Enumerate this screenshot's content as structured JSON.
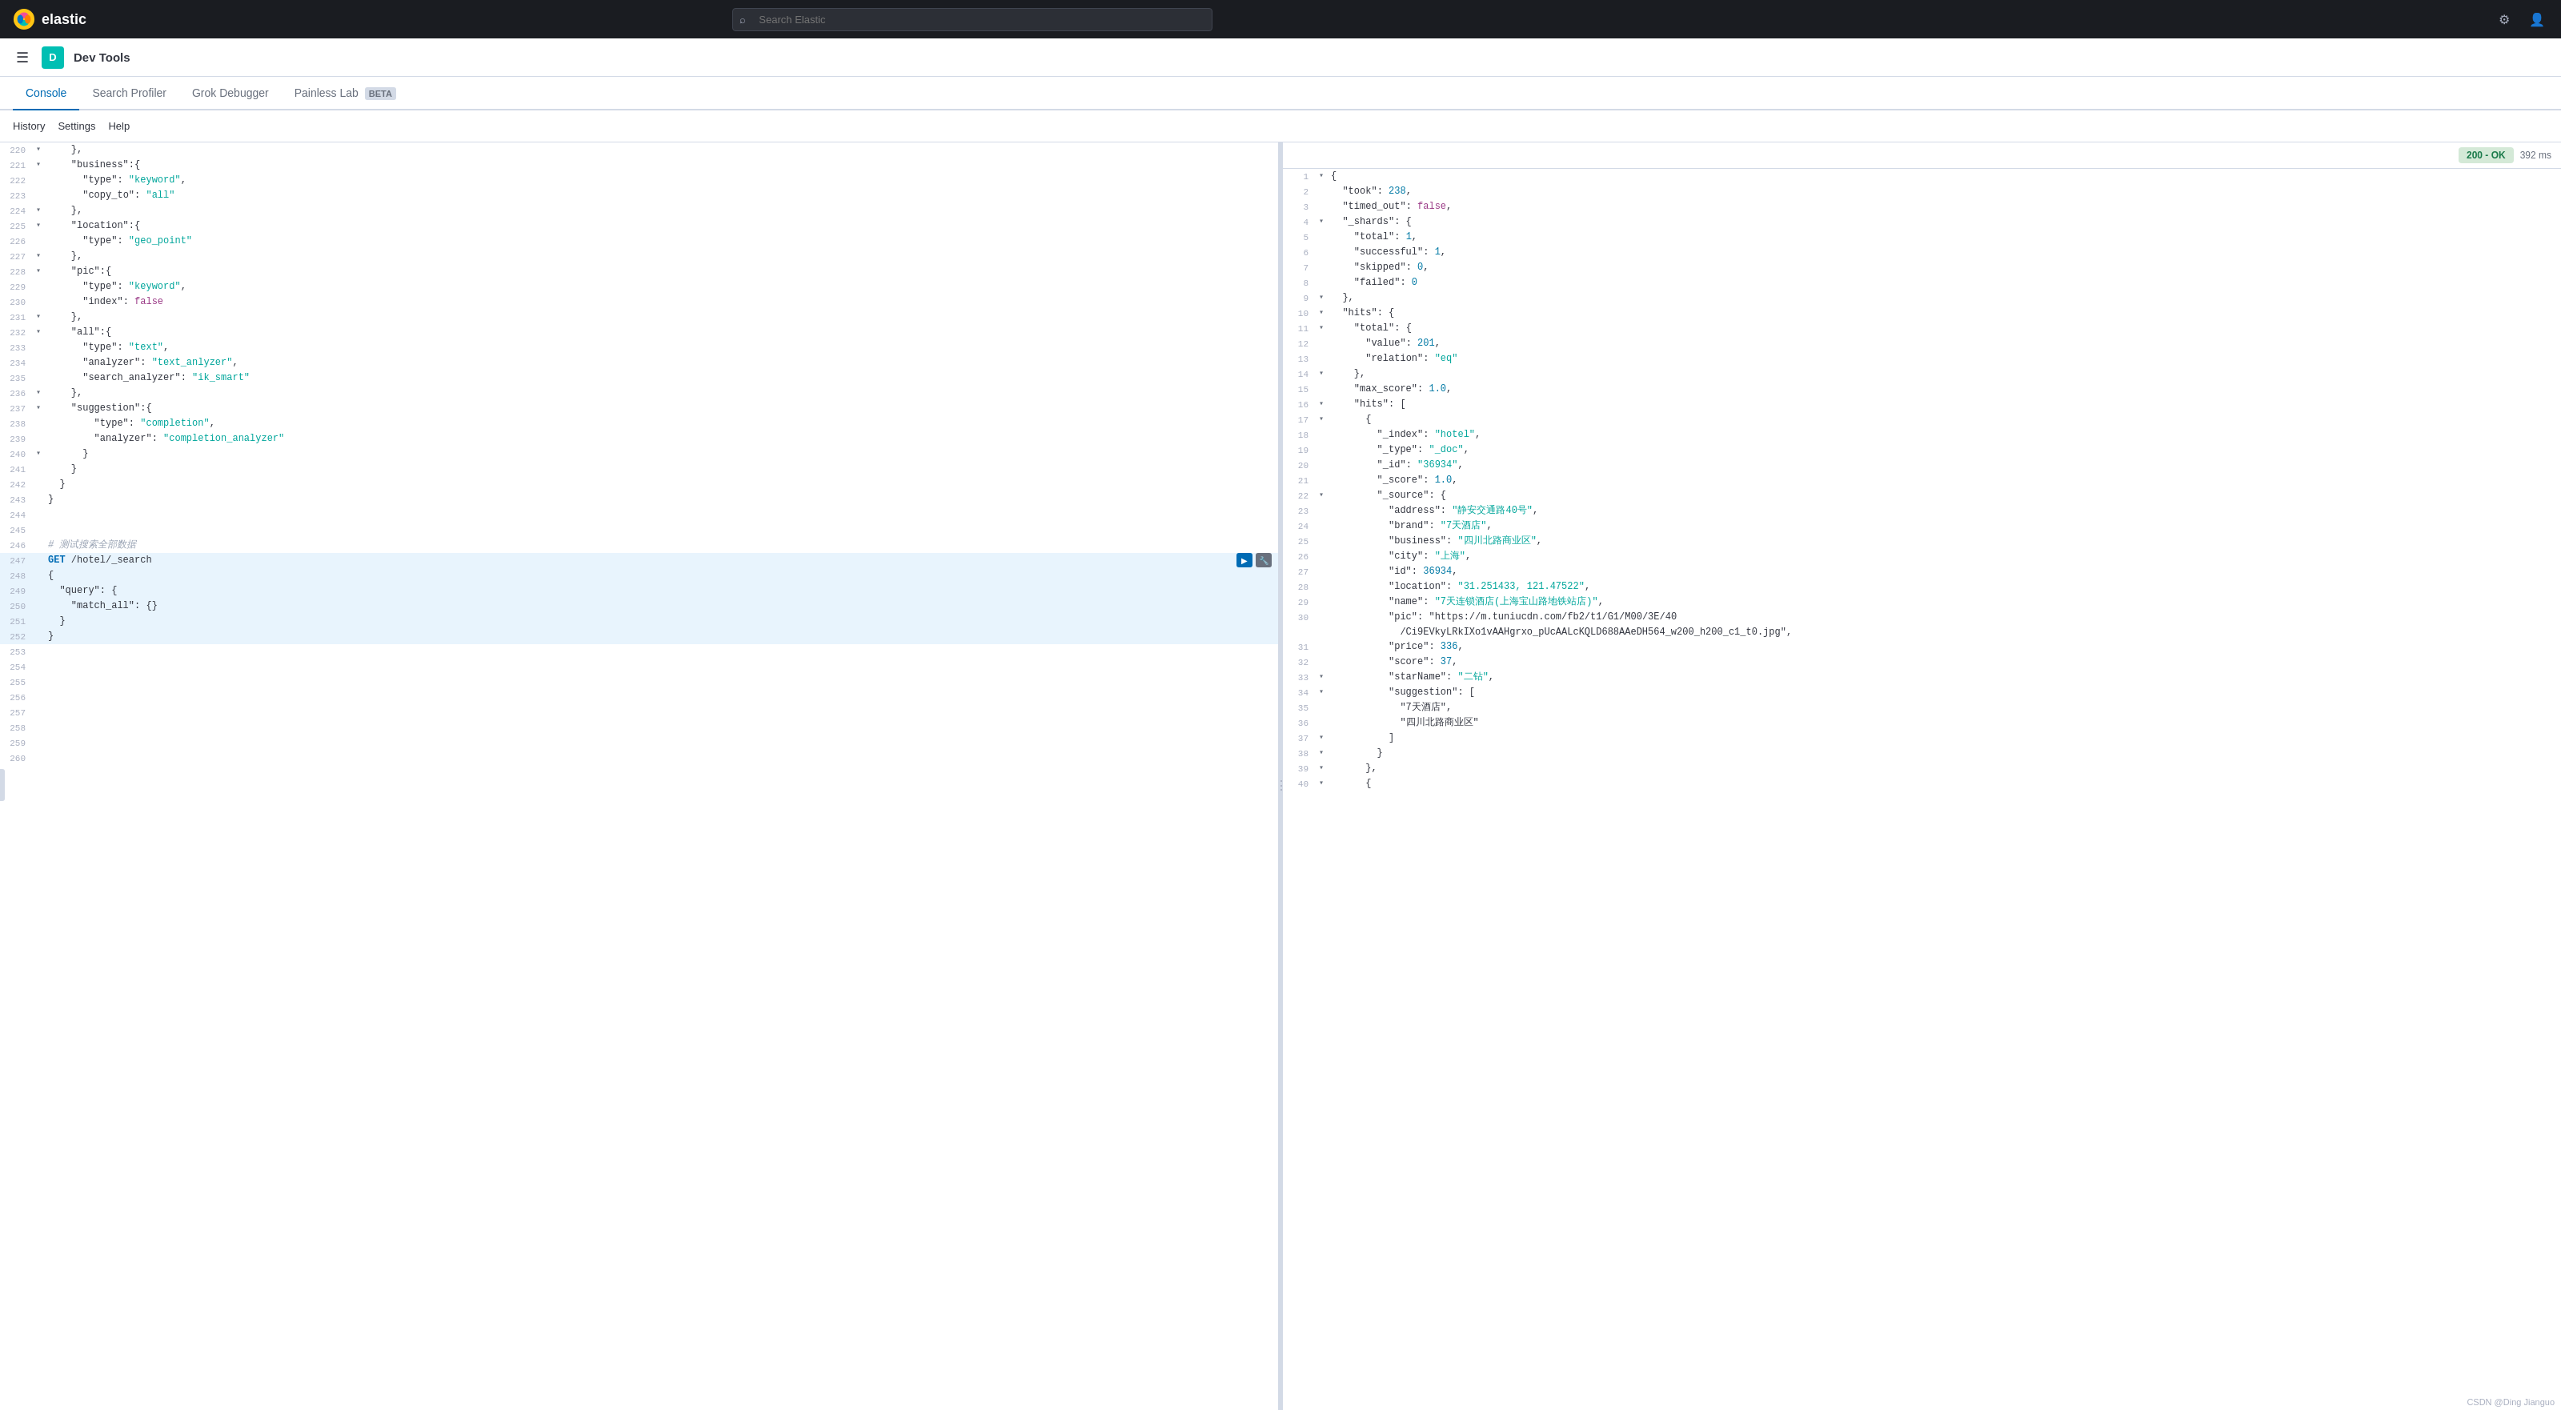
{
  "navbar": {
    "logo_text": "elastic",
    "search_placeholder": "Search Elastic",
    "search_value": ""
  },
  "secondary_header": {
    "app_avatar": "D",
    "app_title": "Dev Tools"
  },
  "tabs": [
    {
      "id": "console",
      "label": "Console",
      "active": true,
      "beta": false
    },
    {
      "id": "search-profiler",
      "label": "Search Profiler",
      "active": false,
      "beta": false
    },
    {
      "id": "grok-debugger",
      "label": "Grok Debugger",
      "active": false,
      "beta": false
    },
    {
      "id": "painless-lab",
      "label": "Painless Lab",
      "active": false,
      "beta": true
    }
  ],
  "beta_label": "BETA",
  "toolbar": {
    "history": "History",
    "settings": "Settings",
    "help": "Help"
  },
  "status": {
    "code": "200 - OK",
    "time": "392 ms"
  },
  "editor_lines": [
    {
      "num": 220,
      "gutter": "▾",
      "content": "    },"
    },
    {
      "num": 221,
      "gutter": "▾",
      "content": "    \"business\":{"
    },
    {
      "num": 222,
      "gutter": "",
      "content": "      \"type\": \"keyword\","
    },
    {
      "num": 223,
      "gutter": "",
      "content": "      \"copy_to\": \"all\""
    },
    {
      "num": 224,
      "gutter": "▾",
      "content": "    },"
    },
    {
      "num": 225,
      "gutter": "▾",
      "content": "    \"location\":{"
    },
    {
      "num": 226,
      "gutter": "",
      "content": "      \"type\": \"geo_point\""
    },
    {
      "num": 227,
      "gutter": "▾",
      "content": "    },"
    },
    {
      "num": 228,
      "gutter": "▾",
      "content": "    \"pic\":{"
    },
    {
      "num": 229,
      "gutter": "",
      "content": "      \"type\": \"keyword\","
    },
    {
      "num": 230,
      "gutter": "",
      "content": "      \"index\": false"
    },
    {
      "num": 231,
      "gutter": "▾",
      "content": "    },"
    },
    {
      "num": 232,
      "gutter": "▾",
      "content": "    \"all\":{"
    },
    {
      "num": 233,
      "gutter": "",
      "content": "      \"type\": \"text\","
    },
    {
      "num": 234,
      "gutter": "",
      "content": "      \"analyzer\": \"text_anlyzer\","
    },
    {
      "num": 235,
      "gutter": "",
      "content": "      \"search_analyzer\": \"ik_smart\""
    },
    {
      "num": 236,
      "gutter": "▾",
      "content": "    },"
    },
    {
      "num": 237,
      "gutter": "▾",
      "content": "    \"suggestion\":{"
    },
    {
      "num": 238,
      "gutter": "",
      "content": "        \"type\": \"completion\","
    },
    {
      "num": 239,
      "gutter": "",
      "content": "        \"analyzer\": \"completion_analyzer\""
    },
    {
      "num": 240,
      "gutter": "▾",
      "content": "      }"
    },
    {
      "num": 241,
      "gutter": "",
      "content": "    }"
    },
    {
      "num": 242,
      "gutter": "",
      "content": "  }"
    },
    {
      "num": 243,
      "gutter": "",
      "content": "}"
    },
    {
      "num": 244,
      "gutter": "",
      "content": ""
    },
    {
      "num": 245,
      "gutter": "",
      "content": ""
    },
    {
      "num": 246,
      "gutter": "",
      "content": "# 测试搜索全部数据"
    },
    {
      "num": 247,
      "gutter": "",
      "content": "GET /hotel/_search",
      "active": true,
      "has_actions": true
    },
    {
      "num": 248,
      "gutter": "",
      "content": "{",
      "active": true
    },
    {
      "num": 249,
      "gutter": "",
      "content": "  \"query\": {",
      "active": true
    },
    {
      "num": 250,
      "gutter": "",
      "content": "    \"match_all\": {}",
      "active": true
    },
    {
      "num": 251,
      "gutter": "",
      "content": "  }",
      "active": true
    },
    {
      "num": 252,
      "gutter": "",
      "content": "}",
      "active": true
    },
    {
      "num": 253,
      "gutter": "",
      "content": ""
    },
    {
      "num": 254,
      "gutter": "",
      "content": ""
    },
    {
      "num": 255,
      "gutter": "",
      "content": ""
    },
    {
      "num": 256,
      "gutter": "",
      "content": ""
    },
    {
      "num": 257,
      "gutter": "",
      "content": ""
    },
    {
      "num": 258,
      "gutter": "",
      "content": ""
    },
    {
      "num": 259,
      "gutter": "",
      "content": ""
    },
    {
      "num": 260,
      "gutter": "",
      "content": ""
    }
  ],
  "output_lines": [
    {
      "num": 1,
      "gutter": "▾",
      "content": "{"
    },
    {
      "num": 2,
      "gutter": "",
      "content": "  \"took\" : 238,"
    },
    {
      "num": 3,
      "gutter": "",
      "content": "  \"timed_out\" : false,"
    },
    {
      "num": 4,
      "gutter": "▾",
      "content": "  \"_shards\" : {"
    },
    {
      "num": 5,
      "gutter": "",
      "content": "    \"total\" : 1,"
    },
    {
      "num": 6,
      "gutter": "",
      "content": "    \"successful\" : 1,"
    },
    {
      "num": 7,
      "gutter": "",
      "content": "    \"skipped\" : 0,"
    },
    {
      "num": 8,
      "gutter": "",
      "content": "    \"failed\" : 0"
    },
    {
      "num": 9,
      "gutter": "▾",
      "content": "  },"
    },
    {
      "num": 10,
      "gutter": "▾",
      "content": "  \"hits\" : {"
    },
    {
      "num": 11,
      "gutter": "▾",
      "content": "    \"total\" : {"
    },
    {
      "num": 12,
      "gutter": "",
      "content": "      \"value\" : 201,"
    },
    {
      "num": 13,
      "gutter": "",
      "content": "      \"relation\" : \"eq\""
    },
    {
      "num": 14,
      "gutter": "▾",
      "content": "    },"
    },
    {
      "num": 15,
      "gutter": "",
      "content": "    \"max_score\" : 1.0,"
    },
    {
      "num": 16,
      "gutter": "▾",
      "content": "    \"hits\" : ["
    },
    {
      "num": 17,
      "gutter": "▾",
      "content": "      {"
    },
    {
      "num": 18,
      "gutter": "",
      "content": "        \"_index\" : \"hotel\","
    },
    {
      "num": 19,
      "gutter": "",
      "content": "        \"_type\" : \"_doc\","
    },
    {
      "num": 20,
      "gutter": "",
      "content": "        \"_id\" : \"36934\","
    },
    {
      "num": 21,
      "gutter": "",
      "content": "        \"_score\" : 1.0,"
    },
    {
      "num": 22,
      "gutter": "▾",
      "content": "        \"_source\" : {"
    },
    {
      "num": 23,
      "gutter": "",
      "content": "          \"address\" : \"静安交通路40号\","
    },
    {
      "num": 24,
      "gutter": "",
      "content": "          \"brand\" : \"7天酒店\","
    },
    {
      "num": 25,
      "gutter": "",
      "content": "          \"business\" : \"四川北路商业区\","
    },
    {
      "num": 26,
      "gutter": "",
      "content": "          \"city\" : \"上海\","
    },
    {
      "num": 27,
      "gutter": "",
      "content": "          \"id\" : 36934,"
    },
    {
      "num": 28,
      "gutter": "",
      "content": "          \"location\" : \"31.251433, 121.47522\","
    },
    {
      "num": 29,
      "gutter": "",
      "content": "          \"name\" : \"7天连锁酒店(上海宝山路地铁站店)\","
    },
    {
      "num": 30,
      "gutter": "",
      "content": "          \"pic\" : \"https://m.tuniucdn.com/fb2/t1/G1/M00/3E/40"
    },
    {
      "num": "",
      "gutter": "",
      "content": "            /Ci9EVkyLRkIXo1vAAHgrxo_pUcAALcKQLD688AAeDH564_w200_h200_c1_t0.jpg\","
    },
    {
      "num": 31,
      "gutter": "",
      "content": "          \"price\" : 336,"
    },
    {
      "num": 32,
      "gutter": "",
      "content": "          \"score\" : 37,"
    },
    {
      "num": 33,
      "gutter": "▾",
      "content": "          \"starName\" : \"二钻\","
    },
    {
      "num": 34,
      "gutter": "▾",
      "content": "          \"suggestion\" : ["
    },
    {
      "num": 35,
      "gutter": "",
      "content": "            \"7天酒店\","
    },
    {
      "num": 36,
      "gutter": "",
      "content": "            \"四川北路商业区\""
    },
    {
      "num": 37,
      "gutter": "▾",
      "content": "          ]"
    },
    {
      "num": 38,
      "gutter": "▾",
      "content": "        }"
    },
    {
      "num": 39,
      "gutter": "▾",
      "content": "      },"
    },
    {
      "num": 40,
      "gutter": "▾",
      "content": "      {"
    }
  ],
  "bottom_credit": "CSDN @Ding Jianguo"
}
